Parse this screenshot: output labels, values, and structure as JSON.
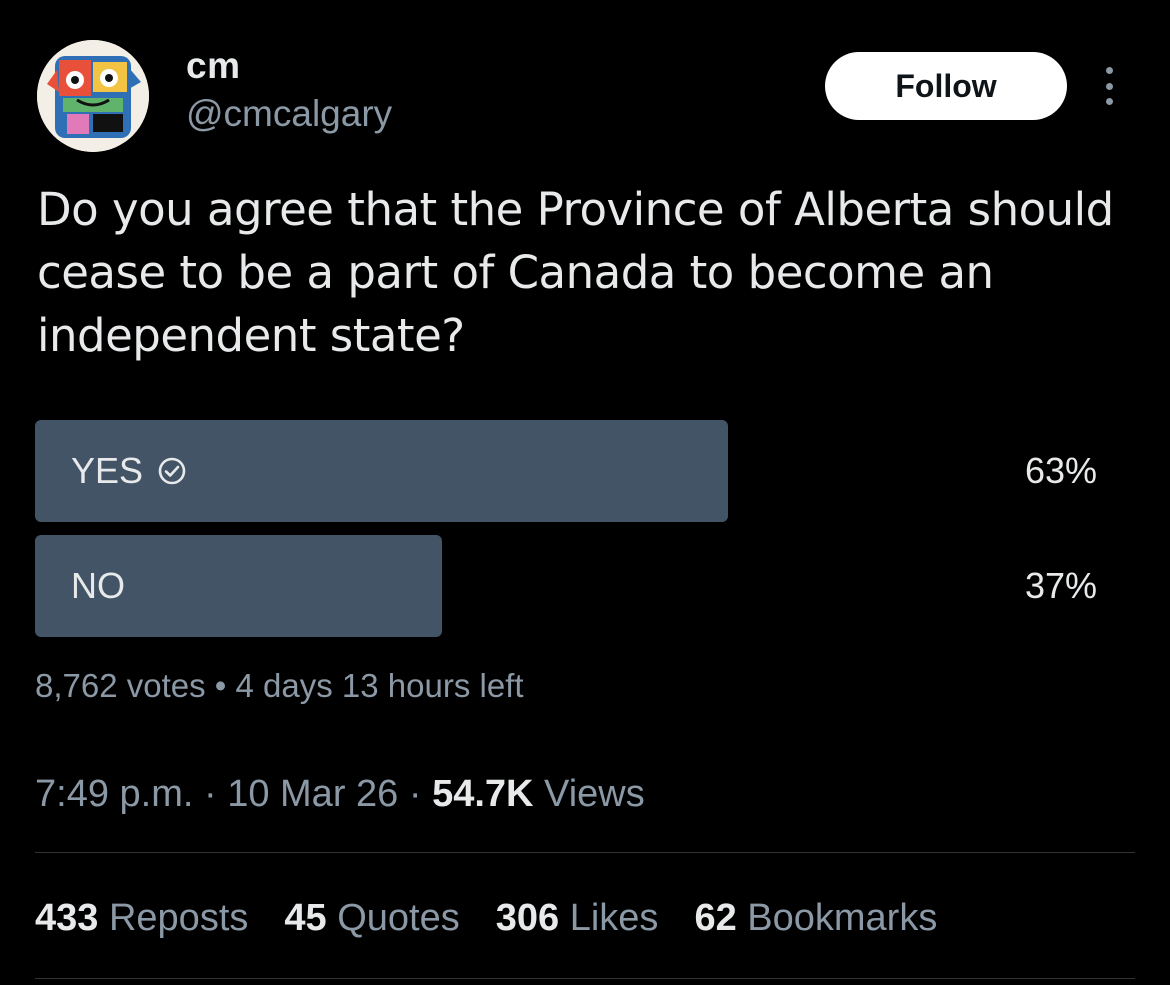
{
  "author": {
    "display_name": "cm",
    "handle": "@cmcalgary"
  },
  "actions": {
    "follow_label": "Follow"
  },
  "tweet": {
    "text": "Do you agree that the Province of Alberta should cease to be a part of Canada to become an independent state?"
  },
  "poll": {
    "options": [
      {
        "label": "YES",
        "percent_text": "63%",
        "percent": 63,
        "selected": true
      },
      {
        "label": "NO",
        "percent_text": "37%",
        "percent": 37,
        "selected": false
      }
    ],
    "votes": "8,762 votes",
    "separator": " • ",
    "time_left": "4 days 13 hours left"
  },
  "meta": {
    "time": "7:49 p.m.",
    "date": "10 Mar 26",
    "views_count": "54.7K",
    "views_label": "Views",
    "separator": " · "
  },
  "stats": [
    {
      "count": "433",
      "label": "Reposts"
    },
    {
      "count": "45",
      "label": "Quotes"
    },
    {
      "count": "306",
      "label": "Likes"
    },
    {
      "count": "62",
      "label": "Bookmarks"
    }
  ],
  "colors": {
    "background": "#000000",
    "text_primary": "#e7e9ea",
    "text_secondary": "#8b98a5",
    "poll_bar": "#435466",
    "follow_button_bg": "#ffffff",
    "divider": "#2f3336"
  },
  "icons": {
    "selected_check": "check-circle-icon",
    "more": "more-vertical-icon"
  }
}
